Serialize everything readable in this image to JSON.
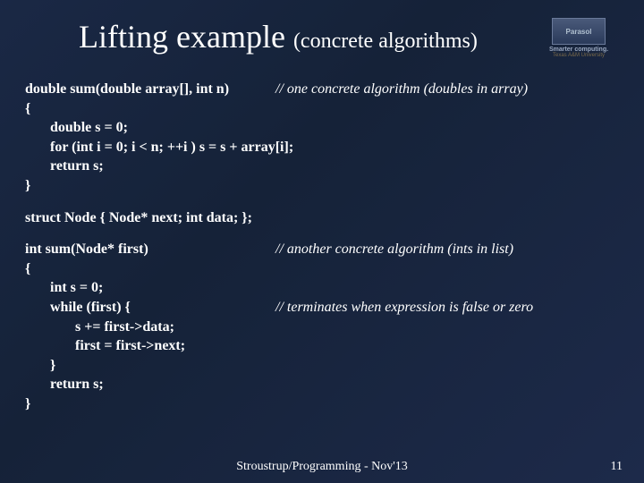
{
  "header": {
    "title_main": "Lifting example ",
    "title_sub": "(concrete algorithms)",
    "logo": {
      "name": "Parasol",
      "tag1": "Smarter computing.",
      "tag2": "Texas A&M University"
    }
  },
  "code": {
    "sig1_bold": "double sum(double array[], int n)",
    "sig1_comment": "// one concrete algorithm (doubles in array)",
    "brace_open": "{",
    "line_s0": "double s = 0;",
    "line_for": "for (int i = 0; i < n; ++i ) s = s + array[i];",
    "line_return": "return s;",
    "brace_close": "}",
    "struct_line": "struct Node { Node* next; int data; };",
    "sig2_bold": "int sum(Node* first)",
    "sig2_comment": "// another concrete algorithm (ints in list)",
    "line2_s0": "int s = 0;",
    "line2_while": "while (first) {",
    "line2_while_comment": "// terminates when expression is false or zero",
    "line2_add": "s += first->data;",
    "line2_next": "first = first->next;",
    "line2_brace": "}",
    "line2_return": "return s;"
  },
  "footer": {
    "text": "Stroustrup/Programming - Nov'13",
    "page": "11"
  }
}
